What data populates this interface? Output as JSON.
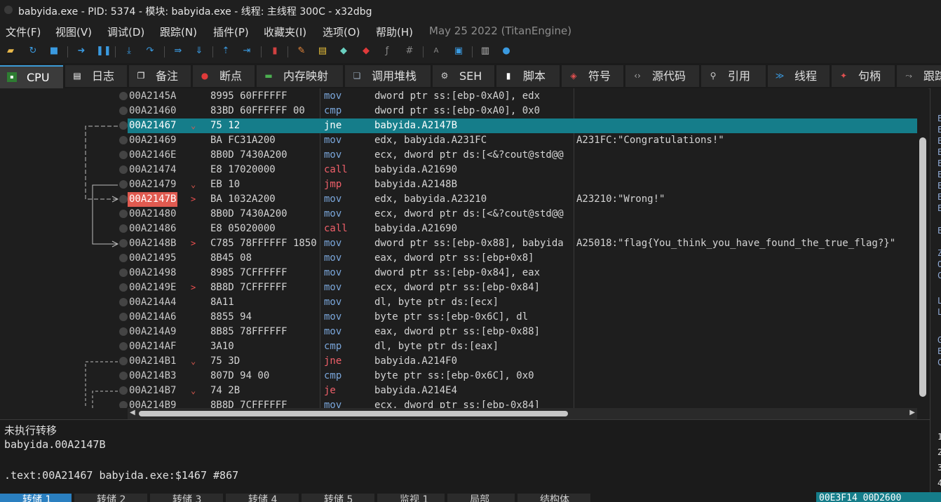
{
  "window": {
    "title": "babyida.exe - PID: 5374 - 模块: babyida.exe - 线程: 主线程 300C - x32dbg"
  },
  "menu": {
    "items": [
      "文件(F)",
      "视图(V)",
      "调试(D)",
      "跟踪(N)",
      "插件(P)",
      "收藏夹(I)",
      "选项(O)",
      "帮助(H)"
    ],
    "build_date": "May 25 2022 (TitanEngine)"
  },
  "toolbar": {
    "icons": [
      "open-icon",
      "restart-icon",
      "stop-icon",
      "run-icon",
      "pause-icon",
      "step-into-icon",
      "step-over-icon",
      "trace-into-icon",
      "trace-over-icon",
      "execute-till-return-icon",
      "run-to-user-code-icon",
      "scylla-icon",
      "highlight-icon",
      "comment-icon",
      "label-icon",
      "bookmark-icon",
      "function-icon",
      "argument-icon",
      "strings-icon",
      "patch-icon",
      "calculator-icon",
      "help-icon"
    ]
  },
  "tabs": [
    {
      "label": "CPU",
      "icon": "cpu-icon",
      "active": true
    },
    {
      "label": "日志",
      "icon": "log-icon"
    },
    {
      "label": "备注",
      "icon": "notes-icon"
    },
    {
      "label": "断点",
      "icon": "breakpoint-icon"
    },
    {
      "label": "内存映射",
      "icon": "memory-map-icon"
    },
    {
      "label": "调用堆栈",
      "icon": "call-stack-icon"
    },
    {
      "label": "SEH",
      "icon": "seh-icon"
    },
    {
      "label": "脚本",
      "icon": "script-icon"
    },
    {
      "label": "符号",
      "icon": "symbols-icon"
    },
    {
      "label": "源代码",
      "icon": "source-icon"
    },
    {
      "label": "引用",
      "icon": "references-icon"
    },
    {
      "label": "线程",
      "icon": "threads-icon"
    },
    {
      "label": "句柄",
      "icon": "handles-icon"
    },
    {
      "label": "跟踪",
      "icon": "trace-icon"
    }
  ],
  "disassembly": {
    "rows": [
      {
        "addr": "00A2145A",
        "bytes": "8995 60FFFFFF",
        "mnemonic": "mov",
        "operands": "dword ptr ss:[ebp-0xA0], edx",
        "comment": ""
      },
      {
        "addr": "00A21460",
        "bytes": "83BD 60FFFFFF 00",
        "mnemonic": "cmp",
        "operands": "dword ptr ss:[ebp-0xA0], 0x0",
        "comment": ""
      },
      {
        "addr": "00A21467",
        "bytes": "75 12",
        "mnemonic": "jne",
        "operands": "babyida.A2147B",
        "comment": "",
        "current": true,
        "marker": "⌄"
      },
      {
        "addr": "00A21469",
        "bytes": "BA FC31A200",
        "mnemonic": "mov",
        "operands": "edx, babyida.A231FC",
        "comment": "A231FC:\"Congratulations!\""
      },
      {
        "addr": "00A2146E",
        "bytes": "8B0D 7430A200",
        "mnemonic": "mov",
        "operands": "ecx, dword ptr ds:[<&?cout@std@@",
        "comment": ""
      },
      {
        "addr": "00A21474",
        "bytes": "E8 17020000",
        "mnemonic": "call",
        "operands": "babyida.A21690",
        "comment": ""
      },
      {
        "addr": "00A21479",
        "bytes": "EB 10",
        "mnemonic": "jmp",
        "operands": "babyida.A2148B",
        "comment": "",
        "marker": "⌄"
      },
      {
        "addr": "00A2147B",
        "bytes": "BA 1032A200",
        "mnemonic": "mov",
        "operands": "edx, babyida.A23210",
        "comment": "A23210:\"Wrong!\"",
        "eip": true,
        "marker": ">"
      },
      {
        "addr": "00A21480",
        "bytes": "8B0D 7430A200",
        "mnemonic": "mov",
        "operands": "ecx, dword ptr ds:[<&?cout@std@@",
        "comment": ""
      },
      {
        "addr": "00A21486",
        "bytes": "E8 05020000",
        "mnemonic": "call",
        "operands": "babyida.A21690",
        "comment": ""
      },
      {
        "addr": "00A2148B",
        "bytes": "C785 78FFFFFF 1850",
        "mnemonic": "mov",
        "operands": "dword ptr ss:[ebp-0x88], babyida",
        "comment": "A25018:\"flag{You_think_you_have_found_the_true_flag?}\"",
        "marker": ">"
      },
      {
        "addr": "00A21495",
        "bytes": "8B45 08",
        "mnemonic": "mov",
        "operands": "eax, dword ptr ss:[ebp+0x8]",
        "comment": ""
      },
      {
        "addr": "00A21498",
        "bytes": "8985 7CFFFFFF",
        "mnemonic": "mov",
        "operands": "dword ptr ss:[ebp-0x84], eax",
        "comment": ""
      },
      {
        "addr": "00A2149E",
        "bytes": "8B8D 7CFFFFFF",
        "mnemonic": "mov",
        "operands": "ecx, dword ptr ss:[ebp-0x84]",
        "comment": "",
        "marker": ">"
      },
      {
        "addr": "00A214A4",
        "bytes": "8A11",
        "mnemonic": "mov",
        "operands": "dl, byte ptr ds:[ecx]",
        "comment": ""
      },
      {
        "addr": "00A214A6",
        "bytes": "8855 94",
        "mnemonic": "mov",
        "operands": "byte ptr ss:[ebp-0x6C], dl",
        "comment": ""
      },
      {
        "addr": "00A214A9",
        "bytes": "8B85 78FFFFFF",
        "mnemonic": "mov",
        "operands": "eax, dword ptr ss:[ebp-0x88]",
        "comment": ""
      },
      {
        "addr": "00A214AF",
        "bytes": "3A10",
        "mnemonic": "cmp",
        "operands": "dl, byte ptr ds:[eax]",
        "comment": ""
      },
      {
        "addr": "00A214B1",
        "bytes": "75 3D",
        "mnemonic": "jne",
        "operands": "babyida.A214F0",
        "comment": "",
        "marker": "⌄"
      },
      {
        "addr": "00A214B3",
        "bytes": "807D 94 00",
        "mnemonic": "cmp",
        "operands": "byte ptr ss:[ebp-0x6C], 0x0",
        "comment": ""
      },
      {
        "addr": "00A214B7",
        "bytes": "74 2B",
        "mnemonic": "je",
        "operands": "babyida.A214E4",
        "comment": "",
        "marker": "⌄"
      },
      {
        "addr": "00A214B9",
        "bytes": "8B8D 7CFFFFFF",
        "mnemonic": "mov",
        "operands": "ecx, dword ptr ss:[ebp-0x84]",
        "comment": ""
      }
    ]
  },
  "info_panel": {
    "lines": [
      "未执行转移",
      "babyida.00A2147B",
      "",
      ".text:00A21467 babyida.exe:$1467 #867"
    ]
  },
  "dump_tabs": [
    "转储 1",
    "转储 2",
    "转储 3",
    "转储 4",
    "转储 5",
    "监视 1",
    "局部",
    "结构体"
  ],
  "status": {
    "address": "00E3F14 00D2600"
  },
  "right_pane": {
    "letters": [
      "E",
      "E",
      "E",
      "E",
      "E",
      "E",
      "E",
      "E",
      "E",
      "E",
      "Z",
      "O",
      "C",
      "L",
      "L",
      "G",
      "E",
      "C"
    ],
    "numbers": [
      "1",
      "2",
      "3",
      "4"
    ]
  }
}
